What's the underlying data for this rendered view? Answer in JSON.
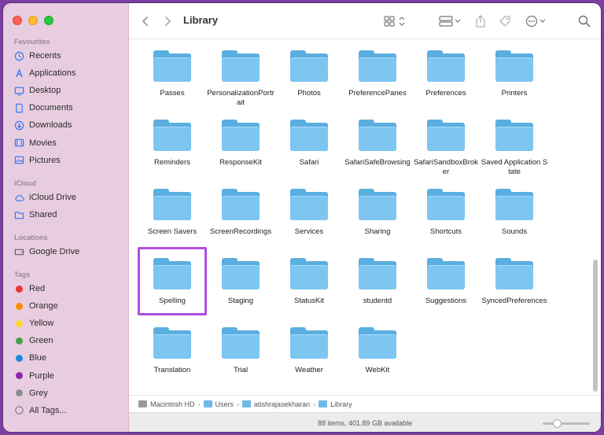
{
  "window": {
    "title": "Library"
  },
  "sidebar": {
    "sections": [
      {
        "title": "Favourites",
        "items": [
          {
            "label": "Recents",
            "icon": "clock-icon"
          },
          {
            "label": "Applications",
            "icon": "applications-icon"
          },
          {
            "label": "Desktop",
            "icon": "desktop-icon"
          },
          {
            "label": "Documents",
            "icon": "document-icon"
          },
          {
            "label": "Downloads",
            "icon": "download-icon"
          },
          {
            "label": "Movies",
            "icon": "film-icon"
          },
          {
            "label": "Pictures",
            "icon": "photo-icon"
          }
        ]
      },
      {
        "title": "iCloud",
        "items": [
          {
            "label": "iCloud Drive",
            "icon": "cloud-icon"
          },
          {
            "label": "Shared",
            "icon": "shared-folder-icon"
          }
        ]
      },
      {
        "title": "Locations",
        "items": [
          {
            "label": "Google Drive",
            "icon": "drive-icon"
          }
        ]
      },
      {
        "title": "Tags",
        "items": [
          {
            "label": "Red",
            "color": "#e53935"
          },
          {
            "label": "Orange",
            "color": "#fb8c00"
          },
          {
            "label": "Yellow",
            "color": "#fdd835"
          },
          {
            "label": "Green",
            "color": "#43a047"
          },
          {
            "label": "Blue",
            "color": "#1e88e5"
          },
          {
            "label": "Purple",
            "color": "#8e24aa"
          },
          {
            "label": "Grey",
            "color": "#8d8d8d"
          },
          {
            "label": "All Tags...",
            "icon": "all-tags-icon"
          }
        ]
      }
    ]
  },
  "folders": [
    "Passes",
    "PersonalizationPortrait",
    "Photos",
    "PreferencePanes",
    "Preferences",
    "Printers",
    "Reminders",
    "ResponseKit",
    "Safari",
    "SafariSafeBrowsing",
    "SafariSandboxBroker",
    "Saved Application State",
    "Screen Savers",
    "ScreenRecordings",
    "Services",
    "Sharing",
    "Shortcuts",
    "Sounds",
    "Spelling",
    "Staging",
    "StatusKit",
    "studentd",
    "Suggestions",
    "SyncedPreferences",
    "Translation",
    "Trial",
    "Weather",
    "WebKit"
  ],
  "highlighted_folder": "Spelling",
  "pathbar": [
    "Macintosh HD",
    "Users",
    "atishrajasekharan",
    "Library"
  ],
  "status": {
    "text": "88 items, 401.89 GB available",
    "zoom_level": 0.3
  },
  "colors": {
    "sidebar_bg": "#e8cde0",
    "folder_front": "#7ec6f2",
    "folder_back": "#5aaee0",
    "highlight": "#b14de0"
  }
}
